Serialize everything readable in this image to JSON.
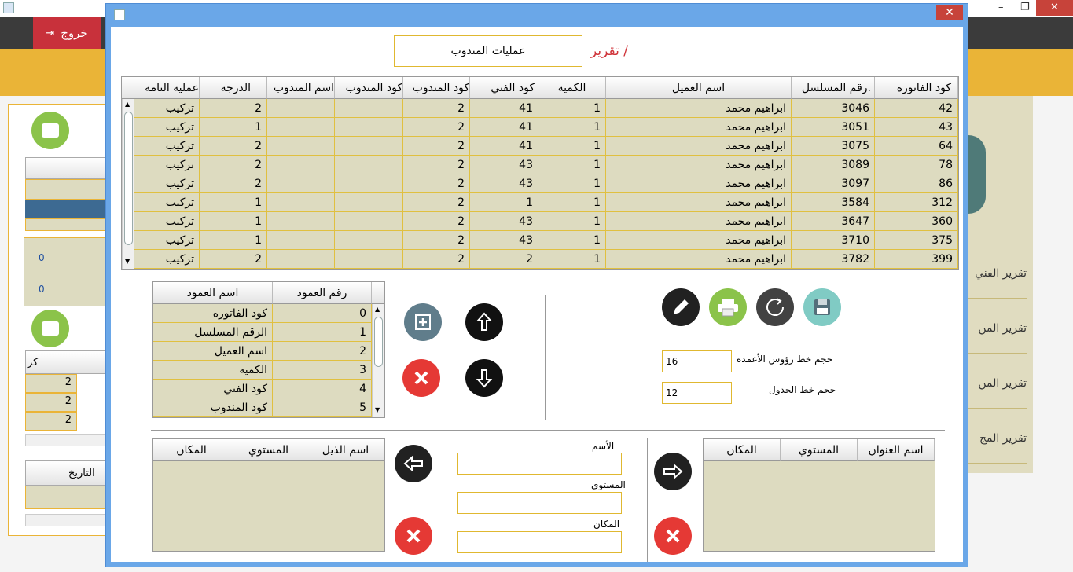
{
  "background": {
    "exit_label": "خروج",
    "window_controls": [
      "–",
      "❐",
      "✕"
    ],
    "left_values": [
      "0",
      "0"
    ],
    "left_grid_values": [
      "2",
      "2",
      "2"
    ],
    "left_headers": [
      "كر",
      "التاريخ"
    ],
    "side_links": [
      "تقرير الفني",
      "تقرير المن",
      "تقرير المن",
      "تقرير المج"
    ]
  },
  "dialog": {
    "close": "✕",
    "report_label": "تقرير /",
    "report_value": "عمليات المندوب"
  },
  "main_table": {
    "headers": [
      "كود الفاتوره",
      "رقم المسلسل.",
      "اسم العميل",
      "الكميه",
      "كود الفني",
      "كود المندوب",
      "كود المندوب",
      "اسم المندوب",
      "الدرجه",
      "عمليه التامه"
    ],
    "rows": [
      [
        "42",
        "3046",
        "ابراهيم محمد",
        "1",
        "41",
        "2",
        "",
        "",
        "2",
        "تركيب"
      ],
      [
        "43",
        "3051",
        "ابراهيم محمد",
        "1",
        "41",
        "2",
        "",
        "",
        "1",
        "تركيب"
      ],
      [
        "64",
        "3075",
        "ابراهيم محمد",
        "1",
        "41",
        "2",
        "",
        "",
        "2",
        "تركيب"
      ],
      [
        "78",
        "3089",
        "ابراهيم محمد",
        "1",
        "43",
        "2",
        "",
        "",
        "2",
        "تركيب"
      ],
      [
        "86",
        "3097",
        "ابراهيم محمد",
        "1",
        "43",
        "2",
        "",
        "",
        "2",
        "تركيب"
      ],
      [
        "312",
        "3584",
        "ابراهيم محمد",
        "1",
        "1",
        "2",
        "",
        "",
        "1",
        "تركيب"
      ],
      [
        "360",
        "3647",
        "ابراهيم محمد",
        "1",
        "43",
        "2",
        "",
        "",
        "1",
        "تركيب"
      ],
      [
        "375",
        "3710",
        "ابراهيم محمد",
        "1",
        "43",
        "2",
        "",
        "",
        "1",
        "تركيب"
      ],
      [
        "399",
        "3782",
        "ابراهيم محمد",
        "1",
        "2",
        "2",
        "",
        "",
        "2",
        "تركيب"
      ]
    ]
  },
  "columns_table": {
    "headers": [
      "رقم العمود",
      "اسم العمود"
    ],
    "rows": [
      [
        "0",
        "كود الفاتوره"
      ],
      [
        "1",
        "الرقم المسلسل"
      ],
      [
        "2",
        "اسم العميل"
      ],
      [
        "3",
        "الكميه"
      ],
      [
        "4",
        "كود الفني"
      ],
      [
        "5",
        "كود المندوب"
      ]
    ]
  },
  "settings": {
    "header_font_label": "حجم خط رؤوس الأعمده",
    "header_font_value": "16",
    "table_font_label": "حجم خط الجدول",
    "table_font_value": "12"
  },
  "titles_table": {
    "headers": [
      "اسم العنوان",
      "المستوي",
      "المكان"
    ]
  },
  "footer_table": {
    "headers": [
      "اسم الذيل",
      "المستوي",
      "المكان"
    ]
  },
  "form": {
    "name_label": "الأسم",
    "level_label": "المستوي",
    "place_label": "المكان"
  },
  "colors": {
    "dialog_border": "#6aa7e8",
    "cell_bg": "#dddbc0",
    "accent_yellow": "#eab437",
    "report_red": "#d0343a"
  }
}
